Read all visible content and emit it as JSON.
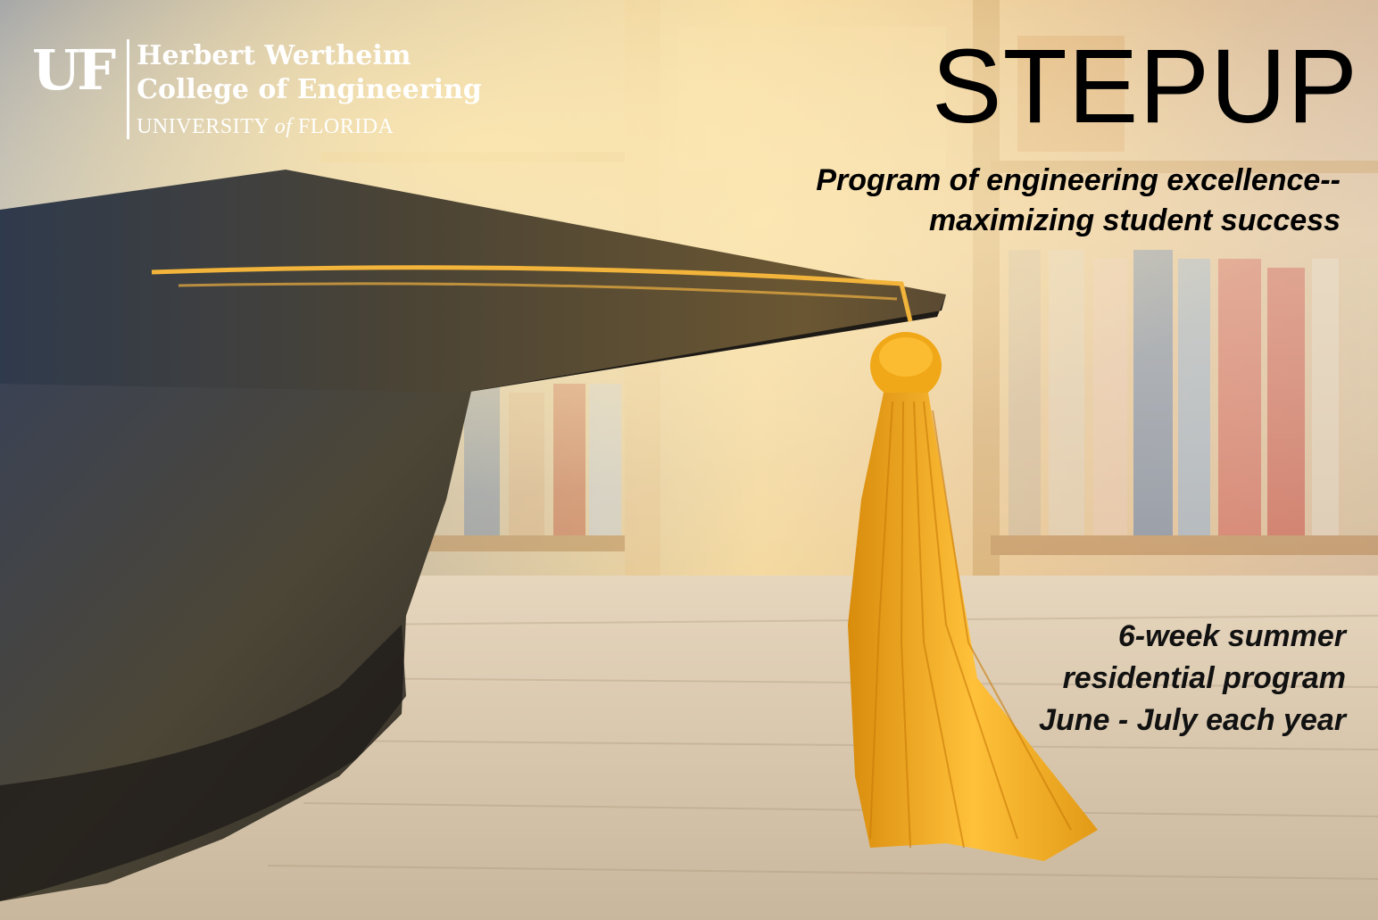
{
  "logo": {
    "mark": "UF",
    "line1": "Herbert Wertheim",
    "line2": "College of Engineering",
    "line3_pre": "UNIVERSITY ",
    "line3_em": "of",
    "line3_post": " FLORIDA"
  },
  "headline": "STEPUP",
  "tagline": {
    "line1": "Program of engineering excellence--",
    "line2": "maximizing student success"
  },
  "details": {
    "line1": "6-week summer",
    "line2": "residential program",
    "line3": "June - July each year"
  },
  "colors": {
    "tassel": "#f2a81c",
    "cap": "#3a3630",
    "headline_text": "#000000",
    "logo_text": "#ffffff"
  },
  "icons": [
    "uf-logo-icon",
    "graduation-cap-icon",
    "tassel-icon"
  ]
}
